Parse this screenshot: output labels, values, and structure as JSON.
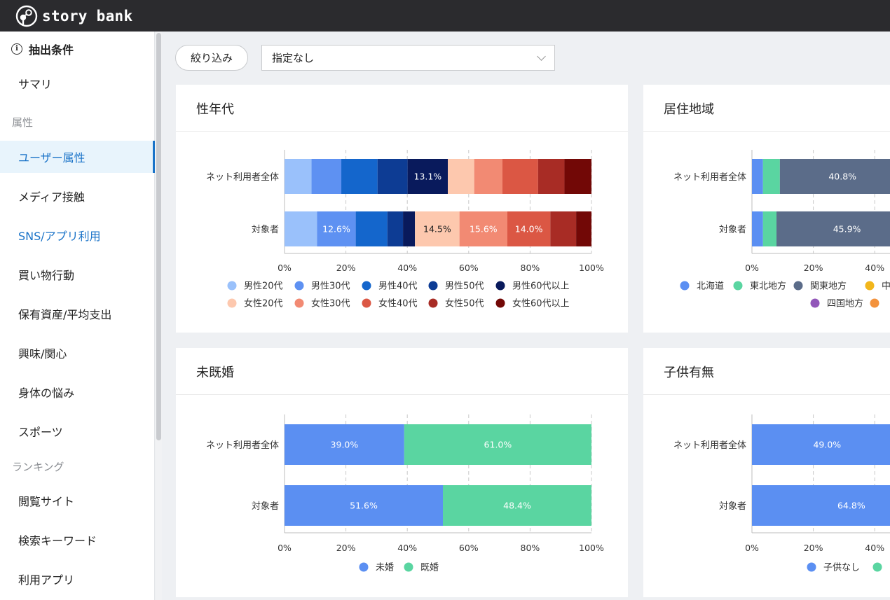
{
  "app": {
    "name": "story bank"
  },
  "sidebar": {
    "header": "抽出条件",
    "items": [
      {
        "label": "サマリ"
      },
      {
        "section": "属性"
      },
      {
        "label": "ユーザー属性",
        "active": true
      },
      {
        "label": "メディア接触"
      },
      {
        "label": "SNS/アプリ利用",
        "highlight": true
      },
      {
        "label": "買い物行動"
      },
      {
        "label": "保有資産/平均支出"
      },
      {
        "label": "興味/関心"
      },
      {
        "label": "身体の悩み"
      },
      {
        "label": "スポーツ"
      },
      {
        "section": "ランキング"
      },
      {
        "label": "閲覧サイト"
      },
      {
        "label": "検索キーワード"
      },
      {
        "label": "利用アプリ"
      }
    ]
  },
  "filter": {
    "button_label": "絞り込み",
    "select_value": "指定なし"
  },
  "colors": {
    "accent": "#1a73c8",
    "topbar": "#2b2b2e"
  },
  "chart_data": [
    {
      "type": "bar",
      "orientation": "horizontal",
      "stacked": true,
      "title": "性年代",
      "categories": [
        "ネット利用者全体",
        "対象者"
      ],
      "x_ticks": [
        "0%",
        "20%",
        "40%",
        "60%",
        "80%",
        "100%"
      ],
      "xlim": [
        0,
        100
      ],
      "legend_position": "bottom",
      "series": [
        {
          "name": "男性20代",
          "color": "#9ac1fb",
          "values": [
            8.8,
            10.6
          ]
        },
        {
          "name": "男性30代",
          "color": "#5e91f2",
          "values": [
            9.7,
            12.6
          ]
        },
        {
          "name": "男性40代",
          "color": "#1466cc",
          "values": [
            11.8,
            10.3
          ]
        },
        {
          "name": "男性50代",
          "color": "#0d3c94",
          "values": [
            9.8,
            5.1
          ]
        },
        {
          "name": "男性60代以上",
          "color": "#091a5c",
          "values": [
            13.1,
            3.9
          ]
        },
        {
          "name": "女性20代",
          "color": "#fdc8ae",
          "values": [
            8.6,
            14.5
          ]
        },
        {
          "name": "女性30代",
          "color": "#f28a73",
          "values": [
            9.2,
            15.6
          ]
        },
        {
          "name": "女性40代",
          "color": "#db5744",
          "values": [
            11.6,
            14.0
          ]
        },
        {
          "name": "女性50代",
          "color": "#a82c25",
          "values": [
            8.6,
            8.4
          ]
        },
        {
          "name": "女性60代以上",
          "color": "#720806",
          "values": [
            8.8,
            5.0
          ]
        }
      ],
      "data_labels": [
        {
          "series": "男性60代以上",
          "category": "ネット利用者全体",
          "text": "13.1%"
        },
        {
          "series": "男性30代",
          "category": "対象者",
          "text": "12.6%"
        },
        {
          "series": "女性20代",
          "category": "対象者",
          "text": "14.5%"
        },
        {
          "series": "女性30代",
          "category": "対象者",
          "text": "15.6%"
        },
        {
          "series": "女性40代",
          "category": "対象者",
          "text": "14.0%"
        }
      ]
    },
    {
      "type": "bar",
      "orientation": "horizontal",
      "stacked": true,
      "title": "居住地域",
      "categories": [
        "ネット利用者全体",
        "対象者"
      ],
      "x_ticks": [
        "0%",
        "20%",
        "40%"
      ],
      "xlim": [
        0,
        100
      ],
      "legend_position": "bottom",
      "series": [
        {
          "name": "北海道",
          "color": "#5b8ff2",
          "values": [
            3.6,
            3.6
          ]
        },
        {
          "name": "東北地方",
          "color": "#5ad5a1",
          "values": [
            5.5,
            4.4
          ]
        },
        {
          "name": "関東地方",
          "color": "#5b6c89",
          "values": [
            40.8,
            45.9
          ]
        }
      ],
      "legend_visible": [
        "北海道",
        "東北地方",
        "関東地方",
        "中",
        "四国地方",
        ""
      ],
      "legend_visible_colors": [
        "#5b8ff2",
        "#5ad5a1",
        "#5b6c89",
        "#f2b61c",
        "#9256b9",
        "#f3923c"
      ],
      "data_labels": [
        {
          "series": "関東地方",
          "category": "ネット利用者全体",
          "text": "40.8%"
        },
        {
          "series": "関東地方",
          "category": "対象者",
          "text": "45.9%"
        }
      ]
    },
    {
      "type": "bar",
      "orientation": "horizontal",
      "stacked": true,
      "title": "未既婚",
      "categories": [
        "ネット利用者全体",
        "対象者"
      ],
      "x_ticks": [
        "0%",
        "20%",
        "40%",
        "60%",
        "80%",
        "100%"
      ],
      "xlim": [
        0,
        100
      ],
      "legend_position": "bottom",
      "series": [
        {
          "name": "未婚",
          "color": "#5b8ff2",
          "values": [
            39.0,
            51.6
          ]
        },
        {
          "name": "既婚",
          "color": "#5ad5a1",
          "values": [
            61.0,
            48.4
          ]
        }
      ],
      "data_labels": [
        {
          "series": "未婚",
          "category": "ネット利用者全体",
          "text": "39.0%"
        },
        {
          "series": "既婚",
          "category": "ネット利用者全体",
          "text": "61.0%"
        },
        {
          "series": "未婚",
          "category": "対象者",
          "text": "51.6%"
        },
        {
          "series": "既婚",
          "category": "対象者",
          "text": "48.4%"
        }
      ]
    },
    {
      "type": "bar",
      "orientation": "horizontal",
      "stacked": true,
      "title": "子供有無",
      "categories": [
        "ネット利用者全体",
        "対象者"
      ],
      "x_ticks": [
        "0%",
        "20%",
        "40%"
      ],
      "xlim": [
        0,
        100
      ],
      "legend_position": "bottom",
      "series": [
        {
          "name": "子供なし",
          "color": "#5b8ff2",
          "values": [
            49.0,
            64.8
          ]
        },
        {
          "name": "",
          "color": "#5ad5a1",
          "values": [
            51.0,
            35.2
          ]
        }
      ],
      "legend_visible": [
        "子供なし",
        ""
      ],
      "legend_visible_colors": [
        "#5b8ff2",
        "#5ad5a1"
      ],
      "data_labels": [
        {
          "series": "子供なし",
          "category": "ネット利用者全体",
          "text": "49.0%"
        },
        {
          "series": "子供なし",
          "category": "対象者",
          "text": "64.8%"
        }
      ]
    }
  ]
}
